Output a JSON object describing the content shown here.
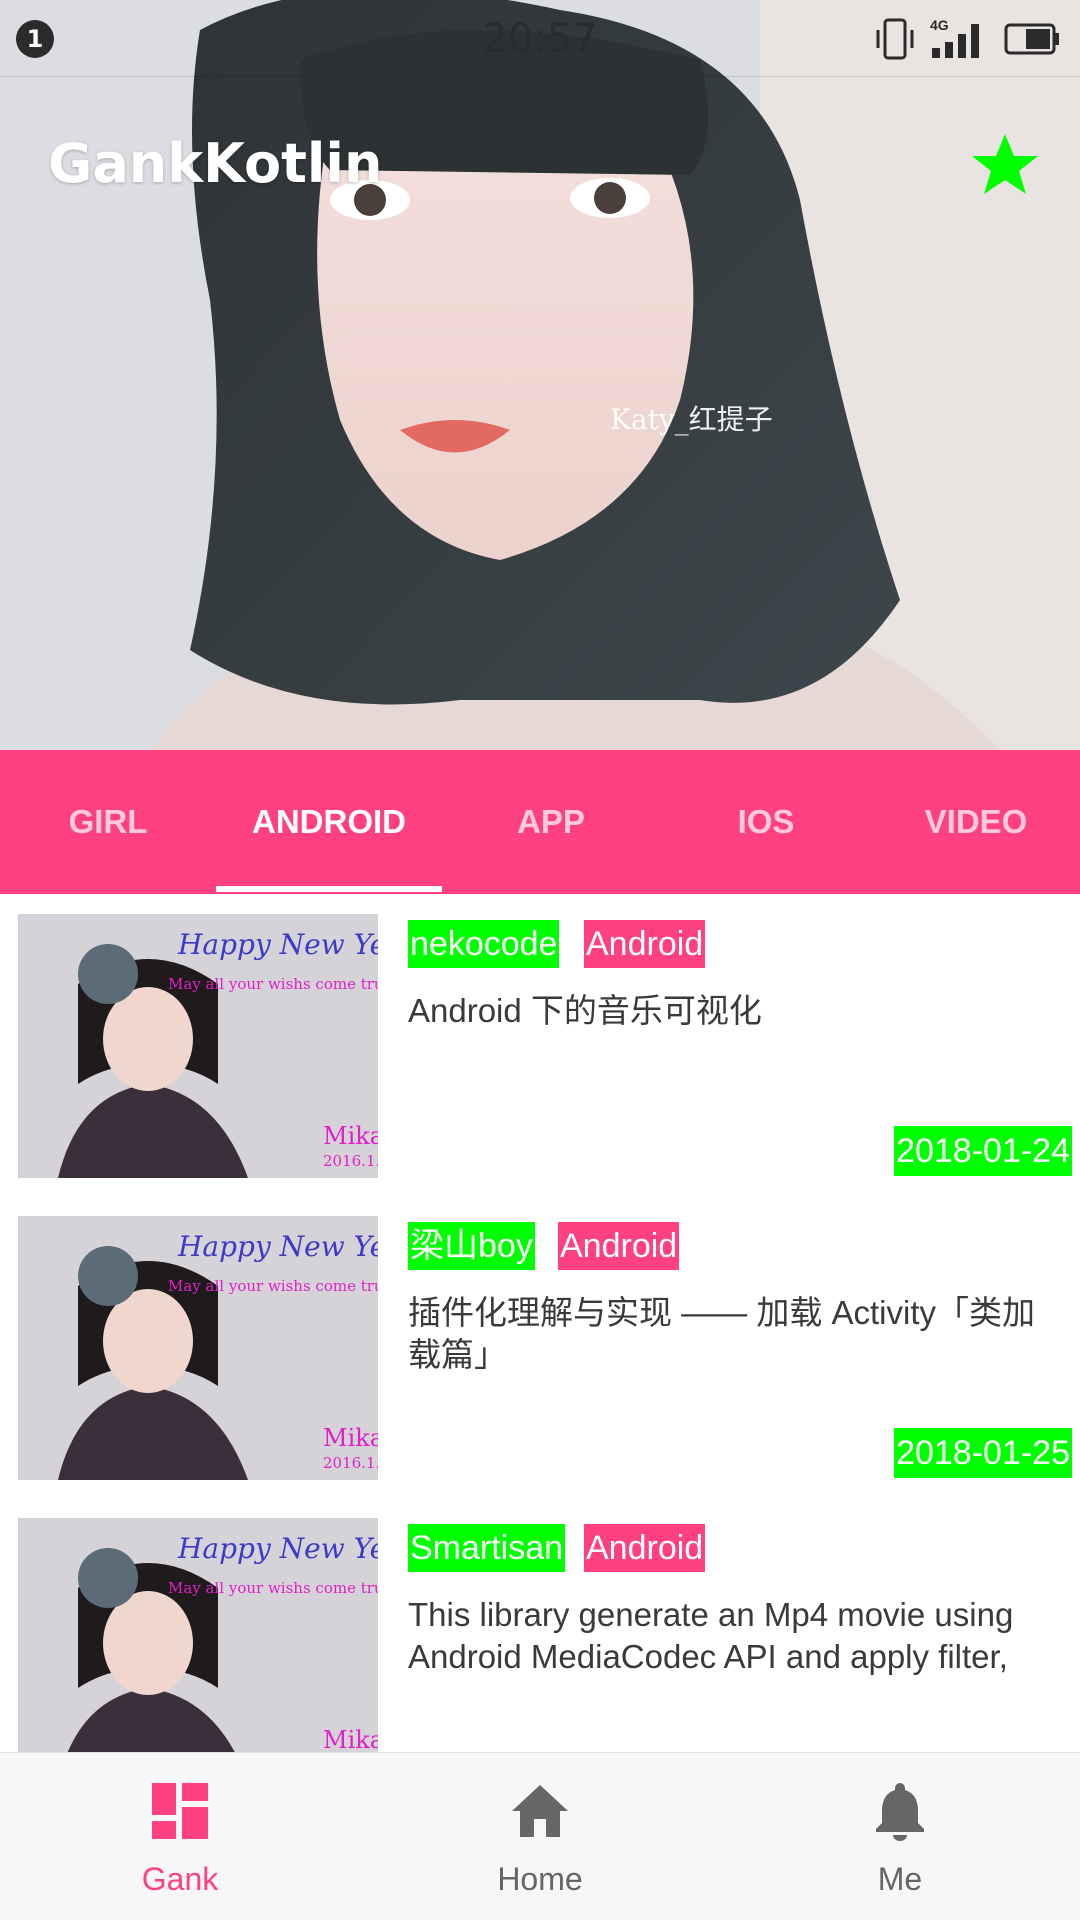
{
  "status_bar": {
    "notification_count": "1",
    "time": "20:57",
    "network_label": "4G"
  },
  "header": {
    "title": "GankKotlin",
    "photo_watermark": "Katy_红提子",
    "favorite_icon": "star-icon",
    "favorite_color": "#00ff00"
  },
  "tabs": [
    {
      "label": "GIRL",
      "active": false
    },
    {
      "label": "ANDROID",
      "active": true
    },
    {
      "label": "APP",
      "active": false
    },
    {
      "label": "IOS",
      "active": false
    },
    {
      "label": "VIDEO",
      "active": false
    }
  ],
  "list": {
    "thumbnail_text": {
      "greeting": "Happy New Year",
      "wish": "May all your wishs come true",
      "name": "Mika",
      "date": "2016.1."
    },
    "items": [
      {
        "author": "nekocode",
        "type": "Android",
        "description": "Android 下的音乐可视化",
        "date": "2018-01-24"
      },
      {
        "author": "梁山boy",
        "type": "Android",
        "description": "插件化理解与实现 —— 加载 Activity「类加载篇」",
        "date": "2018-01-25"
      },
      {
        "author": "Smartisan",
        "type": "Android",
        "description": "This library generate an Mp4 movie using Android MediaCodec API and apply filter,",
        "date": ""
      }
    ]
  },
  "bottom_nav": [
    {
      "label": "Gank",
      "icon": "dashboard-icon",
      "active": true
    },
    {
      "label": "Home",
      "icon": "home-icon",
      "active": false
    },
    {
      "label": "Me",
      "icon": "bell-icon",
      "active": false
    }
  ],
  "colors": {
    "accent_pink": "#ff4081",
    "tag_green": "#00ff00",
    "nav_inactive": "#666666"
  }
}
